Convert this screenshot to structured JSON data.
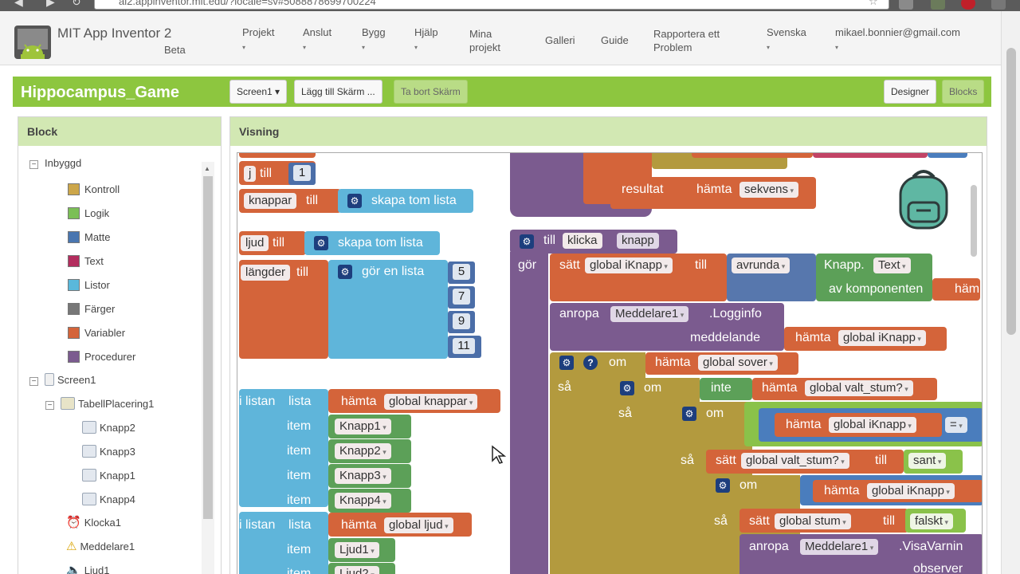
{
  "browser": {
    "url": "ai2.appinventor.mit.edu/?locale=sv#5088878699700224"
  },
  "header": {
    "brand": "MIT App Inventor 2",
    "brand_sub": "Beta",
    "nav": [
      {
        "label": "Projekt",
        "caret": "▾"
      },
      {
        "label": "Anslut",
        "caret": "▾"
      },
      {
        "label": "Bygg",
        "caret": "▾"
      },
      {
        "label": "Hjälp",
        "caret": "▾"
      },
      {
        "label": "Mina\nprojekt"
      },
      {
        "label": "Galleri"
      },
      {
        "label": "Guide"
      },
      {
        "label": "Rapportera ett\nProblem"
      },
      {
        "label": "Svenska",
        "caret": "▾"
      },
      {
        "label": "mikael.bonnier@gmail.com",
        "caret": "▾"
      }
    ]
  },
  "project": {
    "name": "Hippocampus_Game",
    "screen_button": "Screen1 ▾",
    "add_screen": "Lägg till Skärm ...",
    "remove_screen": "Ta bort Skärm",
    "designer": "Designer",
    "blocks": "Blocks"
  },
  "block_panel": {
    "title": "Block",
    "builtin_label": "Inbyggd",
    "builtin": [
      {
        "label": "Kontroll",
        "color": "#cca64a"
      },
      {
        "label": "Logik",
        "color": "#7bbf56"
      },
      {
        "label": "Matte",
        "color": "#4a76b0"
      },
      {
        "label": "Text",
        "color": "#b32d5e"
      },
      {
        "label": "Listor",
        "color": "#5ab8db"
      },
      {
        "label": "Färger",
        "color": "#777777"
      },
      {
        "label": "Variabler",
        "color": "#d4643a"
      },
      {
        "label": "Procedurer",
        "color": "#7b5b8f"
      }
    ],
    "screen_label": "Screen1",
    "table_label": "TabellPlacering1",
    "buttons": [
      "Knapp2",
      "Knapp3",
      "Knapp1",
      "Knapp4"
    ],
    "others": [
      "Klocka1",
      "Meddelare1",
      "Ljud1"
    ]
  },
  "viewer": {
    "title": "Visning",
    "blocks": {
      "j_till": "j",
      "till": "till",
      "one": "1",
      "knappar": "knappar",
      "skapa_tom_lista": "skapa tom lista",
      "ljud": "ljud",
      "langder": "längder",
      "gor_en_lista": "gör en lista",
      "nums": [
        "5",
        "7",
        "9",
        "11"
      ],
      "resultat": "resultat",
      "hamta": "hämta",
      "sekvens": "sekvens",
      "i_listan": "i listan",
      "lista": "lista",
      "item": "item",
      "global_knappar": "global knappar",
      "knapp_items": [
        "Knapp1",
        "Knapp2",
        "Knapp3",
        "Knapp4"
      ],
      "global_ljud": "global ljud",
      "ljud_items": [
        "Ljud1",
        "Ljud2"
      ],
      "klicka": "klicka",
      "knapp": "knapp",
      "gor": "gör",
      "satt": "sätt",
      "global_iknapp": "global iKnapp",
      "avrunda": "avrunda",
      "knapp_dot": "Knapp.",
      "text_prop": "Text",
      "av_komponenten": "av komponenten",
      "ham": "häm",
      "anropa": "anropa",
      "meddelare1": "Meddelare1",
      "logginfo": ".Logginfo",
      "meddelande": "meddelande",
      "om": "om",
      "global_sover": "global sover",
      "sa": "så",
      "inte": "inte",
      "global_valt_stum": "global valt_stum?",
      "equals": "=",
      "sant": "sant",
      "global_stum": "global stum",
      "falskt": "falskt",
      "visavarning": ".VisaVarnin",
      "observer": "observer"
    }
  }
}
